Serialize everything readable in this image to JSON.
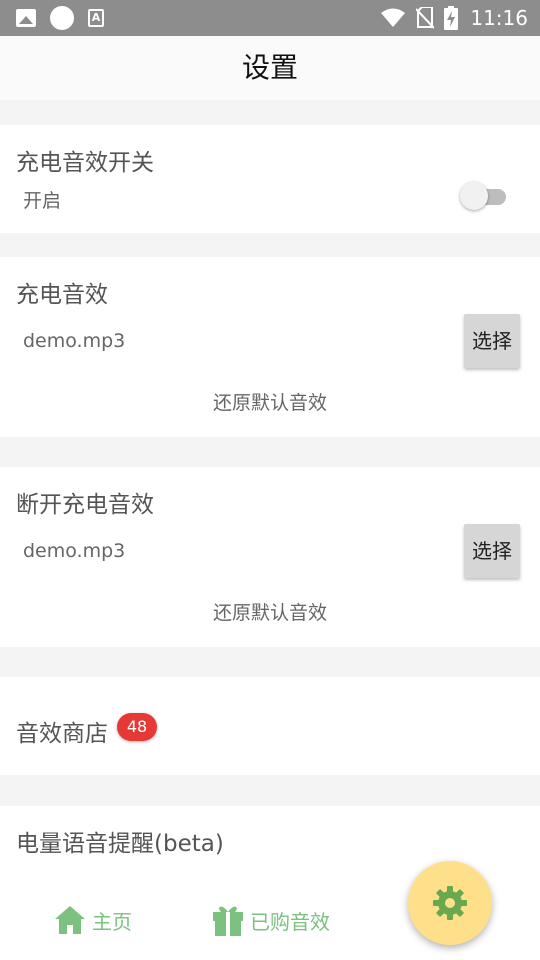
{
  "status_bar": {
    "time": "11:16",
    "left_icons": [
      "image-icon",
      "circle-icon",
      "font-icon"
    ],
    "right_icons": [
      "wifi-icon",
      "no-sim-icon",
      "battery-charging-icon"
    ]
  },
  "header": {
    "title": "设置"
  },
  "sections": {
    "charge_switch": {
      "title": "充电音效开关",
      "state_label": "开启",
      "enabled": false
    },
    "charge_sound": {
      "title": "充电音效",
      "file": "demo.mp3",
      "select_label": "选择",
      "reset_label": "还原默认音效"
    },
    "disconnect_sound": {
      "title": "断开充电音效",
      "file": "demo.mp3",
      "select_label": "选择",
      "reset_label": "还原默认音效"
    },
    "store": {
      "title": "音效商店",
      "badge": "48"
    },
    "voice_reminder": {
      "title": "电量语音提醒(beta)"
    }
  },
  "bottom_nav": {
    "home": {
      "label": "主页",
      "icon": "home-icon"
    },
    "purchased": {
      "label": "已购音效",
      "icon": "gift-icon"
    }
  },
  "fab": {
    "icon": "gear-icon"
  },
  "colors": {
    "nav_green": "#7cc17f",
    "fab_yellow": "#ffe08a",
    "badge_red": "#e53935",
    "status_bar": "#8d8d8d"
  }
}
